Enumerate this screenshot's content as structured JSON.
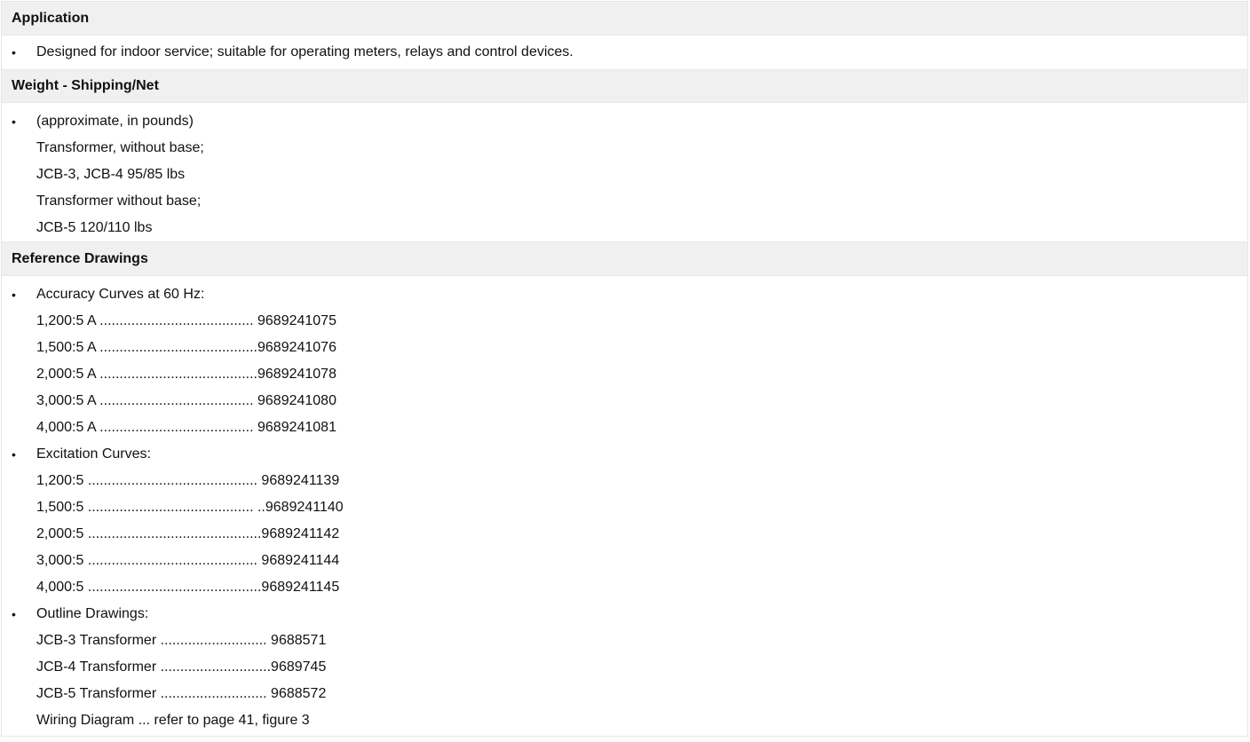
{
  "sections": {
    "application": {
      "title": "Application",
      "lines": [
        {
          "bullet": "•",
          "text": "Designed for indoor service; suitable for operating meters, relays and control devices."
        }
      ]
    },
    "weight": {
      "title": "Weight - Shipping/Net",
      "lines": [
        {
          "bullet": "•",
          "text": "(approximate, in pounds)"
        },
        {
          "bullet": "",
          "text": "Transformer, without base;"
        },
        {
          "bullet": "",
          "text": "JCB-3, JCB-4 95/85 lbs"
        },
        {
          "bullet": "",
          "text": "Transformer without base;"
        },
        {
          "bullet": "",
          "text": "JCB-5 120/110 lbs"
        }
      ]
    },
    "reference": {
      "title": "Reference Drawings",
      "lines": [
        {
          "bullet": "•",
          "text": "Accuracy Curves at 60 Hz:"
        },
        {
          "bullet": "",
          "text": "1,200:5 A ....................................... 9689241075"
        },
        {
          "bullet": "",
          "text": "1,500:5 A ........................................9689241076"
        },
        {
          "bullet": "",
          "text": "2,000:5 A ........................................9689241078"
        },
        {
          "bullet": "",
          "text": "3,000:5 A ....................................... 9689241080"
        },
        {
          "bullet": "",
          "text": "4,000:5 A ....................................... 9689241081"
        },
        {
          "bullet": "•",
          "text": "Excitation Curves:"
        },
        {
          "bullet": "",
          "text": "1,200:5 ........................................... 9689241139"
        },
        {
          "bullet": "",
          "text": "1,500:5 .......................................... ..9689241140"
        },
        {
          "bullet": "",
          "text": "2,000:5 ............................................9689241142"
        },
        {
          "bullet": "",
          "text": "3,000:5 ........................................... 9689241144"
        },
        {
          "bullet": "",
          "text": "4,000:5 ............................................9689241145"
        },
        {
          "bullet": "•",
          "text": "Outline Drawings:"
        },
        {
          "bullet": "",
          "text": "JCB-3 Transformer ........................... 9688571"
        },
        {
          "bullet": "",
          "text": "JCB-4 Transformer ............................9689745"
        },
        {
          "bullet": "",
          "text": "JCB-5 Transformer ........................... 9688572"
        },
        {
          "bullet": "",
          "text": "Wiring Diagram ... refer to page 41, figure 3"
        }
      ]
    }
  }
}
